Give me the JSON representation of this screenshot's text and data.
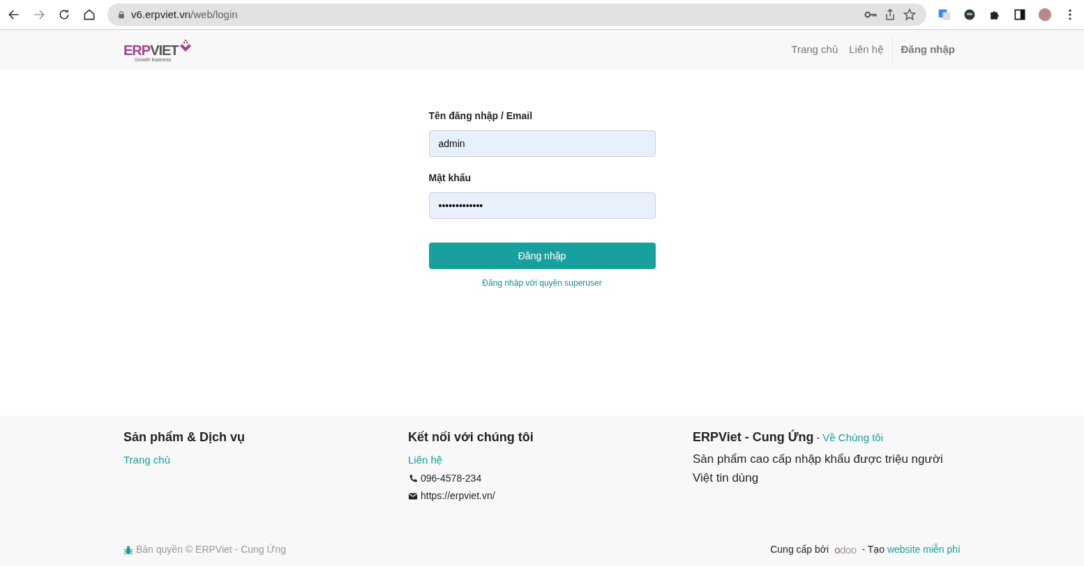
{
  "browser": {
    "url_host": "v6.erpviet.vn",
    "url_path": "/web/login"
  },
  "navbar": {
    "logo": {
      "part_1": "ERP",
      "part_2": "VIET",
      "tagline": "Growth business"
    },
    "items": [
      {
        "label": "Trang chủ",
        "selected": false
      },
      {
        "label": "Liên hệ",
        "selected": false
      },
      {
        "label": "Đăng nhập",
        "selected": true
      }
    ]
  },
  "login_form": {
    "fields": [
      {
        "label": "Tên đăng nhập / Email",
        "value": "admin"
      },
      {
        "label": "Mật khẩu",
        "value": "•••••••••••••"
      }
    ],
    "submit": "Đăng nhập",
    "superuser_link": "Đăng nhập với quyền superuser"
  },
  "footer": {
    "columns": [
      {
        "heading": "Sản phẩm & Dịch vụ",
        "links": [
          "Trang chủ"
        ]
      },
      {
        "heading": "Kết nối với chúng tôi",
        "links": [
          "Liên hệ"
        ],
        "contacts": [
          {
            "kind": "phone",
            "text": "096-4578-234"
          },
          {
            "kind": "email",
            "text": "https://erpviet.vn/"
          }
        ]
      }
    ],
    "about": {
      "heading": "ERPViet - Cung Ứng",
      "separator": "-",
      "link": "Về Chúng tôi",
      "text": "Sản phẩm cao cấp nhập khẩu được triệu người Việt tin dùng"
    },
    "copyright": "Bản quyền © ERPViet - Cung Ứng",
    "powered_by": "Cung cấp bởi",
    "powered_logo": "odoo",
    "create_prefix": "- Tạo",
    "create_link": "website miễn phí"
  }
}
